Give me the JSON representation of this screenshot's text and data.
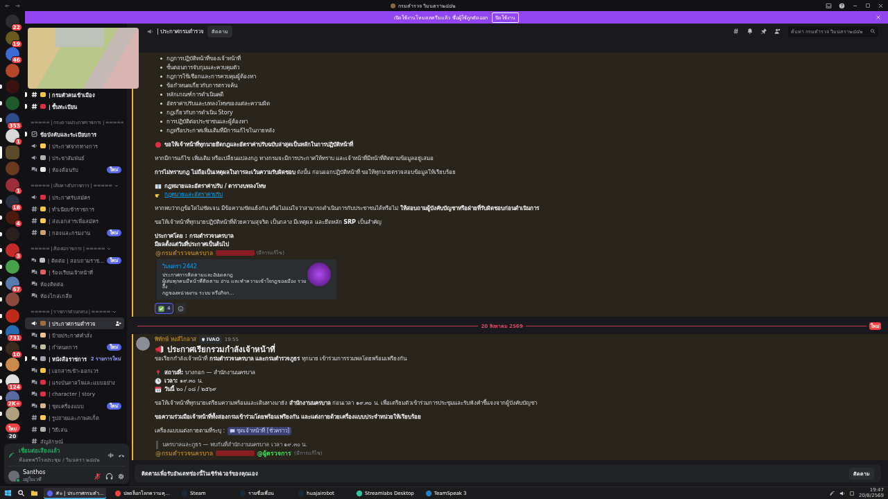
{
  "window": {
    "title": "กรมตำรวจ วิมนตรา๒๔๔๒"
  },
  "banner": {
    "text": "เปิดใช้งานโหมดสตรีมแล้ว ชื่อผู้ใช้ถูกตัดออก",
    "button": "ปิดใช้งาน"
  },
  "servers": [
    {
      "kind": "server",
      "badge": "22",
      "unread": false,
      "selected": false
    },
    {
      "kind": "server",
      "badge": "19",
      "unread": false,
      "selected": false
    },
    {
      "kind": "server",
      "badge": "46",
      "unread": false,
      "selected": false
    },
    {
      "kind": "server",
      "unread": false,
      "selected": false
    },
    {
      "kind": "server",
      "unread": true,
      "selected": false
    },
    {
      "kind": "server",
      "unread": true,
      "selected": false
    },
    {
      "kind": "server",
      "badge": "353",
      "unread": true,
      "selected": false
    },
    {
      "kind": "server",
      "badge": "1",
      "unread": false,
      "selected": false
    },
    {
      "kind": "server",
      "unread": false,
      "selected": true
    },
    {
      "kind": "server",
      "unread": false,
      "selected": false
    },
    {
      "kind": "server",
      "badge": "1",
      "unread": false,
      "selected": false
    },
    {
      "kind": "server",
      "badge": "18",
      "unread": true,
      "selected": false
    },
    {
      "kind": "server",
      "badge": "4",
      "unread": true,
      "selected": false
    },
    {
      "kind": "server",
      "unread": true,
      "selected": false
    },
    {
      "kind": "server",
      "badge": "3",
      "unread": true,
      "selected": false
    },
    {
      "kind": "server",
      "unread": true,
      "selected": false
    },
    {
      "kind": "server",
      "badge": "67",
      "unread": true,
      "selected": false
    },
    {
      "kind": "server",
      "unread": true,
      "selected": false
    },
    {
      "kind": "server",
      "unread": true,
      "selected": false
    },
    {
      "kind": "server",
      "badge": "731",
      "unread": true,
      "selected": false
    },
    {
      "kind": "server",
      "badge": "10",
      "unread": true,
      "selected": false
    },
    {
      "kind": "server",
      "unread": true,
      "selected": false
    },
    {
      "kind": "server",
      "badge": "124",
      "unread": true,
      "selected": false
    },
    {
      "kind": "server",
      "badge": "2K+",
      "unread": true,
      "selected": false
    },
    {
      "kind": "server",
      "unread": true,
      "selected": false
    },
    {
      "kind": "new_pill",
      "label": "ใหม่",
      "badge": "20"
    }
  ],
  "sidebar": {
    "items": [
      {
        "kind": "text_channel",
        "name": "| กรมตัวคนเข้าเมือง",
        "has_emoji": true,
        "unread": true,
        "selected": false
      },
      {
        "kind": "text_channel",
        "name": "| ขึ้นทะเบียน",
        "has_emoji": true,
        "unread": true,
        "selected": false
      },
      {
        "kind": "category",
        "label": "===== | กระดานประกาศราชการ | ====="
      },
      {
        "kind": "rules_channel",
        "name": "ข้อบังคับและระเบียบการ",
        "has_emoji": false,
        "unread": true,
        "selected": false
      },
      {
        "kind": "announcement_channel",
        "name": "| ประกาศจากทางการ",
        "has_emoji": true,
        "unread": false,
        "selected": false
      },
      {
        "kind": "announcement_channel",
        "name": "| ประชาสัมพันธ์",
        "has_emoji": true,
        "unread": false,
        "selected": false
      },
      {
        "kind": "forum_channel",
        "name": "| ห้องต้อนรับ",
        "has_emoji": true,
        "unread": false,
        "selected": false,
        "badge": "ใหม่"
      },
      {
        "kind": "category",
        "label": "===== | เส้นทางรับราชการ | ====="
      },
      {
        "kind": "announcement_channel",
        "name": "| ประกาศรับสมัคร",
        "has_emoji": true,
        "unread": false,
        "selected": false
      },
      {
        "kind": "text_channel",
        "name": "| ทำเนียบข้าราชการ",
        "has_emoji": true,
        "unread": false,
        "selected": false
      },
      {
        "kind": "text_channel",
        "name": "| ส่งเอกสารเพื่อสมัคร",
        "has_emoji": true,
        "unread": false,
        "selected": false
      },
      {
        "kind": "text_channel",
        "name": "| กองและกรมงาน",
        "has_emoji": true,
        "unread": false,
        "selected": false,
        "badge": "ใหม่"
      },
      {
        "kind": "category",
        "label": "===== | ติดต่อราชการ | ====="
      },
      {
        "kind": "forum_channel",
        "name": "| ติดต่อ | สอบถามราช...",
        "has_emoji": true,
        "unread": false,
        "selected": false,
        "badge": "ใหม่"
      },
      {
        "kind": "forum_channel",
        "name": "| ร้องเรียนเจ้าหน้าที่",
        "has_emoji": true,
        "unread": false,
        "selected": false
      },
      {
        "kind": "forum_channel",
        "name": "ห้องติดต่อ",
        "has_emoji": false,
        "unread": false,
        "selected": false
      },
      {
        "kind": "forum_channel",
        "name": "ห้องไกล่เกลี่ย",
        "has_emoji": false,
        "unread": false,
        "selected": false
      },
      {
        "kind": "category",
        "label": "===== | ราชการส่วนกลาง | ====="
      },
      {
        "kind": "announcement_channel",
        "name": "| ประกาศกรมตำรวจ",
        "has_emoji": true,
        "unread": false,
        "selected": true
      },
      {
        "kind": "forum_channel",
        "name": "| ป้ายประกาศคำสั่ง",
        "has_emoji": true,
        "unread": false,
        "selected": false
      },
      {
        "kind": "forum_channel",
        "name": "| กำหนดการ",
        "has_emoji": true,
        "unread": false,
        "selected": false,
        "badge": "ใหม่"
      },
      {
        "kind": "forum_channel",
        "name": "| หนังสือราชการ",
        "has_emoji": true,
        "unread": true,
        "selected": false,
        "new_count": "2 รายการใหม่"
      },
      {
        "kind": "forum_channel",
        "name": "| เอกสารเข้า-ออกเวร",
        "has_emoji": true,
        "unread": false,
        "selected": false
      },
      {
        "kind": "forum_channel",
        "name": "| แรงบันดาลใจและแบบอย่าง",
        "has_emoji": true,
        "unread": false,
        "selected": false
      },
      {
        "kind": "forum_channel",
        "name": "| character | story",
        "has_emoji": true,
        "unread": false,
        "selected": false
      },
      {
        "kind": "forum_channel",
        "name": "| ชุดเครื่องแบบ",
        "has_emoji": true,
        "unread": false,
        "selected": false,
        "badge": "ใหม่"
      },
      {
        "kind": "text_channel",
        "name": "| รูปถ่ายและภาพสเก็ต",
        "has_emoji": true,
        "unread": false,
        "selected": false
      },
      {
        "kind": "text_channel",
        "name": "| วิธีเล่น",
        "has_emoji": true,
        "unread": false,
        "selected": false
      },
      {
        "kind": "text_channel",
        "name": "สัญลักษณ์",
        "has_emoji": false,
        "unread": false,
        "selected": false
      }
    ]
  },
  "voice": {
    "status": "เชื่อมต่อเสียงแล้ว",
    "room": "ห้องเทพวิโรงประชุม / วิมนตรา ๒๔๔๒"
  },
  "user": {
    "name": "Santhos",
    "status": "อยู่ในเวที",
    "muted": true
  },
  "header": {
    "channel": "| ประกาศกรมตำรวจ",
    "follow": "ติดตาม",
    "search_placeholder": "ค้นหา กรมตำรวจ วิมนตรา๒๔๔๒"
  },
  "chat": {
    "items": [
      {
        "kind": "message",
        "mentions_you": true,
        "blocks": [
          {
            "kind": "bullets",
            "items": [
              "กฎการปฏิบัติหน้าที่ของเจ้าหน้าที่",
              "ขั้นตอนการจับกุมและควบคุมตัว",
              "กฎการใช้เชือกและการควบคุมผู้ต้องหา",
              "ข้อกำหนดเกี่ยวกับการตรวจค้น",
              "หลักเกณฑ์การดำเนินคดี",
              "อัตราค่าปรับและบทลงโทษของแต่ละความผิด",
              "กฎเกี่ยวกับการดำเนิน Story",
              "การปฏิบัติต่อประชาชนและผู้ต้องหา",
              "กฎหรือประกาศเพิ่มเติมที่มีการแก้ไขในภายหลัง"
            ]
          },
          {
            "kind": "alert",
            "text": "ขอให้เจ้าหน้าที่ทุกนายยึดกฎและอัตราค่าปรับฉบับล่าสุดเป็นหลักในการปฏิบัติหน้าที่"
          },
          {
            "kind": "para",
            "text": "หากมีการแก้ไข เพิ่มเติม หรือเปลี่ยนแปลงกฎ ทางกรมจะมีการประกาศให้ทราบ และเจ้าหน้าที่มีหน้าที่ติดตามข้อมูลอยู่เสมอ"
          },
          {
            "kind": "para",
            "text": "**การไม่ทราบกฎ ไม่ถือเป็นเหตุผลในการละเว้นความรับผิดชอบ** ดังนั้น ก่อนออกปฏิบัติหน้าที่ ขอให้ทุกนายตรวจสอบข้อมูลให้เรียบร้อย"
          },
          {
            "kind": "book_heading",
            "text": "กฎหมายและอัตราค่าปรับ / ตารางบทลงโทษ"
          },
          {
            "kind": "link",
            "text": "กฎหมายและอัตราค่าปรับ"
          },
          {
            "kind": "para",
            "text": "หากพบว่ากฎข้อใดไม่ชัดเจน มีข้อความขัดแย้งกัน หรือไม่แน่ใจว่าสามารถดำเนินการกับประชาชนได้หรือไม่ **ให้สอบถามผู้บังคับบัญชาหรือฝ่ายที่รับผิดชอบก่อนดำเนินการ**"
          },
          {
            "kind": "para",
            "text": "ขอให้เจ้าหน้าที่ทุกนายปฏิบัติหน้าที่ด้วยความสุจริต เป็นกลาง มีเหตุผล และยึดหลัก **SRP** เป็นสำคัญ"
          },
          {
            "kind": "bold_lines",
            "lines": [
              "ประกาศโดย : กรมตำรวจนครบาล",
              "มีผลตั้งแต่วันที่ประกาศเป็นต้นไป"
            ]
          },
          {
            "kind": "mentions",
            "items": [
              {
                "kind": "role",
                "text": "@กรมตำรวจนครบาล",
                "color": "#a8782a"
              },
              {
                "kind": "redacted",
                "color": "#8a1c24"
              }
            ],
            "edited": "(มีการแก้ไข)"
          },
          {
            "kind": "embed",
            "title": "วิมนตรา 2442",
            "lines": [
              "ประกาศการติดตามและอัปเดตกฎ",
              "ผู้เล่นทุกคนมีหน้าที่ติดตาม อ่าน และทำความเข้าใจกฎของเมือง รวมถึง",
              "กฎของหน่วยงาน ระบบ หรือกิจก..."
            ]
          },
          {
            "kind": "reactions",
            "items": [
              {
                "count": "4",
                "reacted": true
              }
            ]
          }
        ]
      },
      {
        "kind": "divider",
        "date": "20 สิงหาคม 2569",
        "label": "ใหม่"
      },
      {
        "kind": "message",
        "mentions_you": true,
        "author": "พิทักษ์ หงส์ไกลาส",
        "tag": "IVAO",
        "time": "19:55",
        "blocks": [
          {
            "kind": "title",
            "text": "ประกาศเรียกรวมกำลังเจ้าหน้าที่"
          },
          {
            "kind": "para",
            "text": "ขอเรียกกำลังเจ้าหน้าที่ **กรมตำรวจนครบาล และกรมตำรวจภูธร** ทุกนาย เข้าร่วมการรวมพลโดยพร้อมเพรียงกัน"
          },
          {
            "kind": "pin_line",
            "text": "**สถานที่:** บางกอก — สำนักงานนครบาล"
          },
          {
            "kind": "clock_line",
            "text": "**เวลา:** ๑๙.๓๐ น."
          },
          {
            "kind": "calendar_line",
            "text": "**วันนี้** ๒๐ / ๐๘ / ๒๕๖๙"
          },
          {
            "kind": "para",
            "text": "ขอให้เจ้าหน้าที่ทุกนายเตรียมความพร้อมและเดินทางมายัง **สำนักงานนครบาล** ก่อนเวลา ๑๙.๓๐ น. เพื่อเตรียมตัวเข้าร่วมการประชุมและรับฟังคำชี้แจงจากผู้บังคับบัญชา"
          },
          {
            "kind": "para",
            "text": "**ขอความร่วมมือเจ้าหน้าที่ทั้งสองกรมเข้าร่วมโดยพร้อมเพรียงกัน และแต่งกายด้วยเครื่องแบบประจำหน่วยให้เรียบร้อย**"
          },
          {
            "kind": "channel_ref",
            "text": "เครื่องแบบแต่งกายตามที่ระบุ :",
            "channel": "ชุดเจ้าหน้าที่ [ชั่วคราว]"
          },
          {
            "kind": "quote",
            "text": "นครบาลและภูธร — พบกันที่สำนักงานนครบาล เวลา ๑๙.๓๐ น."
          },
          {
            "kind": "mentions",
            "items": [
              {
                "kind": "role",
                "text": "@กรมตำรวจนครบาล",
                "color": "#a8782a"
              },
              {
                "kind": "redacted",
                "color": "#8a1c24"
              },
              {
                "kind": "role",
                "text": "@ผู้ตรวจการ",
                "color": "#3ee05a"
              }
            ],
            "edited": "(มีการแก้ไข)"
          }
        ]
      }
    ]
  },
  "composer": {
    "text": "ติดตามเพื่อรับอัพเดทช่องนี้ในเซิร์ฟเวอร์ของคุณเอง",
    "button": "ติดตาม"
  },
  "taskbar": {
    "apps": [
      {
        "kind": "discord",
        "label": "#๏ | ประกาศกรมตำ...",
        "active": true
      },
      {
        "kind": "chrome",
        "label": "ปลดล็อกโลกความคุ...",
        "active": false
      },
      {
        "kind": "steam",
        "label": "Steam",
        "active": false
      },
      {
        "kind": "steam",
        "label": "รายชื่อเพื่อน",
        "active": false
      },
      {
        "kind": "steam",
        "label": "huajairobot",
        "active": false
      },
      {
        "kind": "streamlabs",
        "label": "Streamlabs Desktop",
        "active": false
      },
      {
        "kind": "teamspeak",
        "label": "TeamSpeak 3",
        "active": false
      }
    ],
    "time": "19:47",
    "date": "20/8/2569"
  }
}
